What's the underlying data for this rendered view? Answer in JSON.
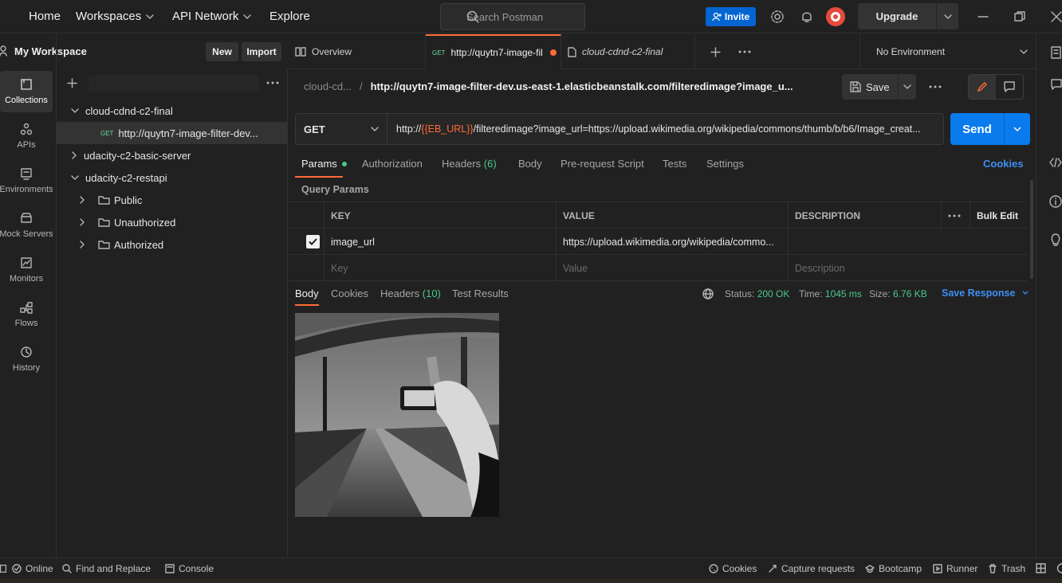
{
  "topbar": {
    "home": "Home",
    "workspaces": "Workspaces",
    "api_network": "API Network",
    "explore": "Explore",
    "search_placeholder": "Search Postman",
    "invite": "Invite",
    "upgrade": "Upgrade"
  },
  "workspace": {
    "name": "My Workspace",
    "new": "New",
    "import": "Import"
  },
  "rail": [
    {
      "label": "Collections",
      "icon": "collections-icon"
    },
    {
      "label": "APIs",
      "icon": "apis-icon"
    },
    {
      "label": "Environments",
      "icon": "environments-icon"
    },
    {
      "label": "Mock Servers",
      "icon": "mock-servers-icon"
    },
    {
      "label": "Monitors",
      "icon": "monitors-icon"
    },
    {
      "label": "Flows",
      "icon": "flows-icon"
    },
    {
      "label": "History",
      "icon": "history-icon"
    }
  ],
  "tree": {
    "c1": "cloud-cdnd-c2-final",
    "c1_req_method": "GET",
    "c1_req": "http://quytn7-image-filter-dev...",
    "c2": "udacity-c2-basic-server",
    "c3": "udacity-c2-restapi",
    "f1": "Public",
    "f2": "Unauthorized",
    "f3": "Authorized"
  },
  "tabs": {
    "overview": "Overview",
    "req_method": "GET",
    "req": "http://quytn7-image-fil",
    "coll": "cloud-cdnd-c2-final",
    "env": "No Environment"
  },
  "request": {
    "crumb_parent": "cloud-cd...",
    "crumb_sep": "/",
    "crumb_title": "http://quytn7-image-filter-dev.us-east-1.elasticbeanstalk.com/filteredimage?image_u...",
    "save": "Save",
    "method": "GET",
    "url_prefix": "http://",
    "url_var": "{{EB_URL}}",
    "url_rest": "/filteredimage?image_url=https://upload.wikimedia.org/wikipedia/commons/thumb/b/b6/Image_creat...",
    "send": "Send"
  },
  "req_tabs": {
    "params": "Params",
    "authorization": "Authorization",
    "headers": "Headers",
    "headers_count": "(6)",
    "body": "Body",
    "prerequest": "Pre-request Script",
    "tests": "Tests",
    "settings": "Settings",
    "cookies": "Cookies"
  },
  "params": {
    "title": "Query Params",
    "col_key": "KEY",
    "col_value": "VALUE",
    "col_desc": "DESCRIPTION",
    "bulk_edit": "Bulk Edit",
    "row_key": "image_url",
    "row_value": "https://upload.wikimedia.org/wikipedia/commo...",
    "ph_key": "Key",
    "ph_value": "Value",
    "ph_desc": "Description"
  },
  "response": {
    "body": "Body",
    "cookies": "Cookies",
    "headers": "Headers",
    "headers_count": "(10)",
    "test_results": "Test Results",
    "status_label": "Status:",
    "status": "200 OK",
    "time_label": "Time:",
    "time": "1045 ms",
    "size_label": "Size:",
    "size": "6.76 KB",
    "save_response": "Save Response"
  },
  "statusbar": {
    "online": "Online",
    "find": "Find and Replace",
    "console": "Console",
    "cookies": "Cookies",
    "capture": "Capture requests",
    "bootcamp": "Bootcamp",
    "runner": "Runner",
    "trash": "Trash"
  },
  "colors": {
    "accent": "#ff6c37",
    "send": "#097bed",
    "invite": "#0265d2",
    "success": "#49c98c",
    "link": "#3d8ff5"
  }
}
